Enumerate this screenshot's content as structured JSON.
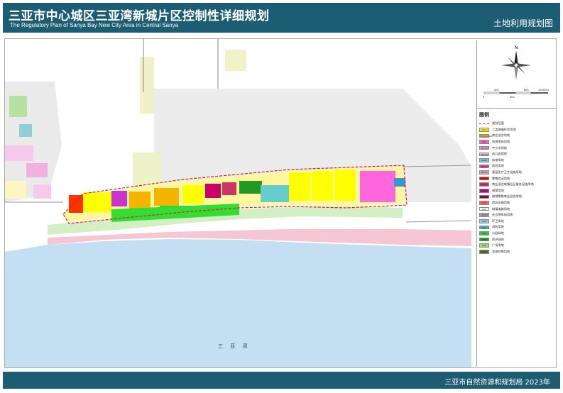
{
  "header": {
    "title_cn": "三亚市中心城区三亚湾新城片区控制性详细规划",
    "title_en": "The Regulatory Plan of Sanya Bay New City Area in Central Sanya",
    "subtitle": "土地利用规划图"
  },
  "map": {
    "bay_label": "三 亚 湾",
    "road_label_right": "凤凰路延长线",
    "road_label_right2": "凤凰路",
    "compass_label": "N",
    "scale_labels": [
      "0",
      "200",
      "400",
      "600",
      "1000(m)"
    ]
  },
  "legend": {
    "title": "图例",
    "boundary_label": "规划范围",
    "items": [
      {
        "code": "070101",
        "label": "二类城镇住宅用地",
        "color": "#ffff00"
      },
      {
        "code": "070101/0901",
        "label": "商住混合用地",
        "color": "#f5b400"
      },
      {
        "code": "0801",
        "label": "机关团体用地",
        "color": "#ff66cc"
      },
      {
        "code": "080403",
        "label": "中小学用地",
        "color": "#ff99dd"
      },
      {
        "code": "080404",
        "label": "幼儿园用地",
        "color": "#f4b6c2"
      },
      {
        "code": "0805",
        "label": "体育用地",
        "color": "#66cccc"
      },
      {
        "code": "080601",
        "label": "医院用地",
        "color": "#ff3399"
      },
      {
        "code": "080602",
        "label": "基层医疗卫生设施用地",
        "color": "#e8a0c0"
      },
      {
        "code": "090101",
        "label": "零售商业用地",
        "color": "#ff0000"
      },
      {
        "code": "090104",
        "label": "商业混合城镇社区服务设施用地",
        "color": "#cc3366"
      },
      {
        "code": "090104",
        "label": "旅馆用地",
        "color": "#cc0099"
      },
      {
        "code": "0904",
        "label": "旅馆零售商业混合用地",
        "color": "#990033"
      },
      {
        "code": "0902",
        "label": "商务金融用地",
        "color": "#ff6666"
      },
      {
        "code": "1207",
        "label": "城镇道路用地",
        "color": "#ffffff"
      },
      {
        "code": "120803",
        "label": "社会停车场用地",
        "color": "#aaaaaa"
      },
      {
        "code": "1302",
        "label": "环卫用地",
        "color": "#99ccdd"
      },
      {
        "code": "1311",
        "label": "消防用地",
        "color": "#33bbbb"
      },
      {
        "code": "1401",
        "label": "公园绿地",
        "color": "#33cc33"
      },
      {
        "code": "1402",
        "label": "防护绿地",
        "color": "#229922"
      },
      {
        "code": "1403",
        "label": "广场用地",
        "color": "#99dd66"
      },
      {
        "code": "1501",
        "label": "其他特殊用地",
        "color": "#557722"
      }
    ]
  },
  "footer": {
    "text": "三亚市自然资源和规划局  2023年"
  }
}
